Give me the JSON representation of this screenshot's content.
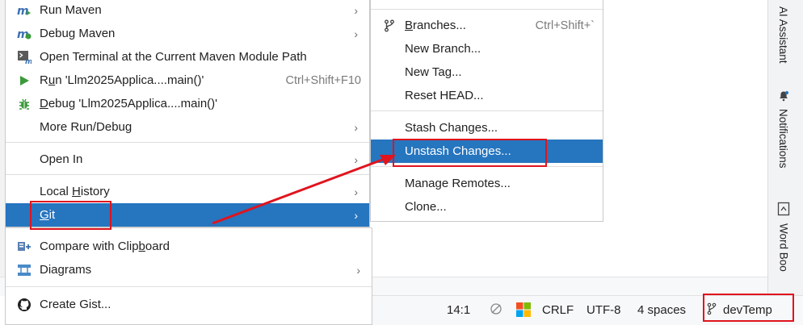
{
  "main_menu": {
    "items": [
      {
        "label": "Run Maven",
        "icon": "maven-run-icon",
        "has_submenu": true
      },
      {
        "label": "Debug Maven",
        "icon": "maven-debug-icon",
        "has_submenu": true
      },
      {
        "label": "Open Terminal at the Current Maven Module Path",
        "icon": "terminal-icon"
      },
      {
        "label_pre": "R",
        "label_ul": "u",
        "label_post": "n 'Llm2025Applica....main()'",
        "shortcut": "Ctrl+Shift+F10",
        "icon": "run-icon"
      },
      {
        "label_pre": "",
        "label_ul": "D",
        "label_post": "ebug 'Llm2025Applica....main()'",
        "icon": "debug-bug-icon"
      },
      {
        "label": "More Run/Debug",
        "has_submenu": true
      },
      {
        "label": "Open In",
        "has_submenu": true
      },
      {
        "label_pre": "Local ",
        "label_ul": "H",
        "label_post": "istory",
        "has_submenu": true
      },
      {
        "label_pre": "",
        "label_ul": "G",
        "label_post": "it",
        "has_submenu": true,
        "selected": true
      },
      {
        "label_pre": "Compare with Clip",
        "label_ul": "b",
        "label_post": "oard",
        "icon": "compare-icon"
      },
      {
        "label": "Diagrams",
        "icon": "diagram-icon",
        "has_submenu": true
      },
      {
        "label": "Create Gist...",
        "icon": "github-icon"
      }
    ]
  },
  "git_menu": {
    "items": [
      {
        "label_pre": "",
        "label_ul": "B",
        "label_post": "ranches...",
        "shortcut": "Ctrl+Shift+`",
        "icon": "branch-icon"
      },
      {
        "label": "New Branch..."
      },
      {
        "label": "New Tag..."
      },
      {
        "label": "Reset HEAD..."
      },
      {
        "label": "Stash Changes..."
      },
      {
        "label": "Unstash Changes...",
        "selected": true
      },
      {
        "label": "Manage Remotes..."
      },
      {
        "label": "Clone..."
      }
    ]
  },
  "right_tools": {
    "ai_assistant": "AI Assistant",
    "notifications": "Notifications",
    "word_book": "Word Boo"
  },
  "status_bar": {
    "position": "14:1",
    "line_separator": "CRLF",
    "encoding": "UTF-8",
    "indent": "4 spaces",
    "branch": "devTemp"
  },
  "colors": {
    "selection": "#2675bf",
    "annotation": "#e0141e"
  }
}
